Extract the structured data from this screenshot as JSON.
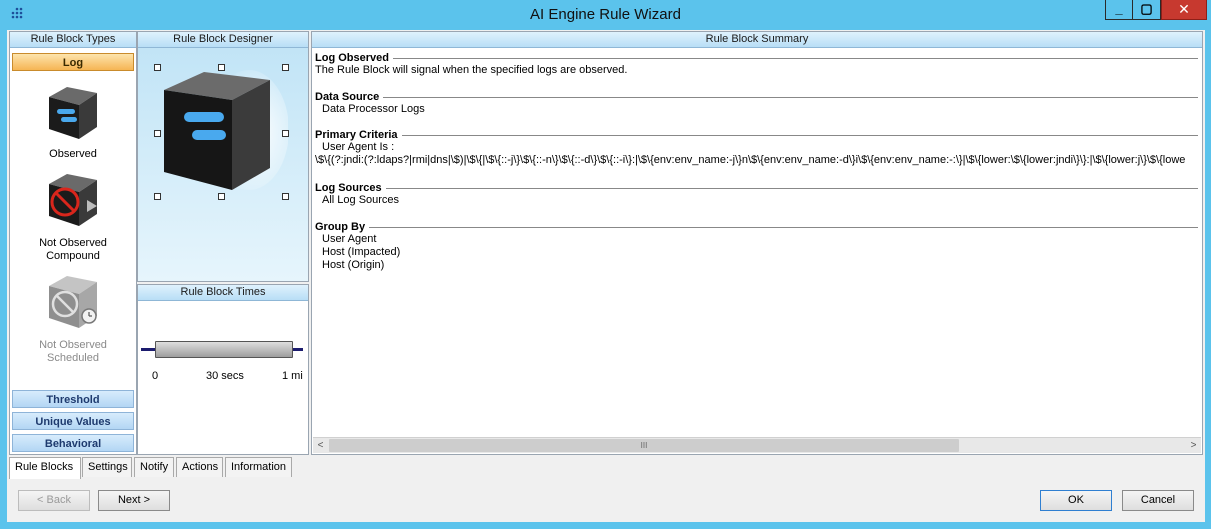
{
  "window": {
    "title": "AI Engine Rule Wizard"
  },
  "title_buttons": {
    "minimize": "_",
    "maximize": "▢",
    "close": "✕"
  },
  "rule_block_types": {
    "header": "Rule Block Types",
    "active_category": "Log",
    "items": [
      {
        "label": "Observed",
        "icon": "observed-cube-icon",
        "enabled": true
      },
      {
        "label": "Not Observed\nCompound",
        "icon": "not-observed-compound-icon",
        "enabled": true
      },
      {
        "label": "Not Observed\nScheduled",
        "icon": "not-observed-scheduled-icon",
        "enabled": false
      }
    ],
    "categories": [
      "Threshold",
      "Unique Values",
      "Behavioral"
    ]
  },
  "designer": {
    "header": "Rule Block Designer",
    "block_icon": "observed-cube-icon"
  },
  "times": {
    "header": "Rule Block Times",
    "scale_labels": [
      "0",
      "30 secs",
      "1 mi"
    ]
  },
  "summary": {
    "header": "Rule Block Summary",
    "sections": [
      {
        "title": "Log Observed",
        "lines": [
          "The Rule Block will signal when the specified logs are observed."
        ],
        "indent": false
      },
      {
        "title": "Data Source",
        "lines": [
          "Data Processor Logs"
        ],
        "indent": true
      },
      {
        "title": "Primary Criteria",
        "lines": [
          "User Agent Is :",
          "\\$\\{(?:jndi:(?:ldaps?|rmi|dns|\\$)|\\$\\{|\\$\\{::-j\\}\\$\\{::-n\\}\\$\\{::-d\\}\\$\\{::-i\\}:|\\$\\{env:env_name:-j\\}n\\$\\{env:env_name:-d\\}i\\$\\{env:env_name:-:\\}|\\$\\{lower:\\$\\{lower:jndi\\}\\}:|\\$\\{lower:j\\}\\$\\{lowe"
        ],
        "indent": true
      },
      {
        "title": "Log Sources",
        "lines": [
          "All Log Sources"
        ],
        "indent": true
      },
      {
        "title": "Group By",
        "lines": [
          "User Agent",
          "Host (Impacted)",
          "Host (Origin)"
        ],
        "indent": true
      }
    ],
    "scroll_grip": "III",
    "scroll_left": "<",
    "scroll_right": ">"
  },
  "tabs": [
    "Rule Blocks",
    "Settings",
    "Notify",
    "Actions",
    "Information"
  ],
  "active_tab": "Rule Blocks",
  "buttons": {
    "back": "< Back",
    "next": "Next >",
    "ok": "OK",
    "cancel": "Cancel"
  },
  "colors": {
    "titlebar": "#5bc3ec",
    "close_button": "#c7392f",
    "active_category": "#f6b554",
    "category": "#b3d6f4"
  }
}
